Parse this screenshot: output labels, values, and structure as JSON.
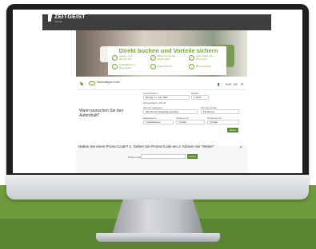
{
  "header": {
    "logo_text": "ZEITGEIST",
    "logo_sub": "Vienna"
  },
  "hero": {
    "title": "Direkt buchen und Vorteile sichern",
    "benefits": [
      "Kosten- und Service frei",
      "Beste Preise auf dieser Seite",
      "Late Check-Out bis 14 Uhr",
      "10% Rabatt im Restaurant",
      "Freies WLAN",
      "Bar-Gutschein"
    ]
  },
  "navbar": {
    "brand": "Nachhaltiges Hotel",
    "icon_person": "person-icon",
    "currency": "EUR",
    "language": "DE",
    "menu_icon": "menu-icon"
  },
  "form": {
    "question": "Wann wünschen Sie den Aufenthalt?",
    "arrival_label": "Anreisedatum",
    "arrival_value": "Montag, 17. Juli, 2023",
    "nights_label": "Nächte",
    "nights_value": "1 Nacht",
    "departure_note": "Abreisedatum Juli 18",
    "room_cat_label": "Zimmer Kategorie",
    "room_cat_value": "Alle Zimmer Kategorien anzeigen",
    "rooms_label": "Zimmer Anzahl",
    "rooms_value": "Ein Zimmer",
    "adults_label": "Erwachsene",
    "adults_value": "1 Erwachsener",
    "children_label": "Kinder bis 5",
    "children_value": "0 Kinder",
    "children2_label": "Kinder bis 12",
    "children2_value": "0 Kinder",
    "submit_label": "Weiter"
  },
  "promo": {
    "question": "Haben Sie einen Promo Code? 1. Geben Sie Promo-Code ein 2. Klicken Sie \"Weiter\"",
    "input_label": "Promo Code",
    "button_label": "Weiter",
    "toggle": "▲"
  },
  "colors": {
    "accent": "#78a33a",
    "dark": "#3e3e3e",
    "button": "#5b8a2e",
    "background_green": "#6f9a3e"
  }
}
